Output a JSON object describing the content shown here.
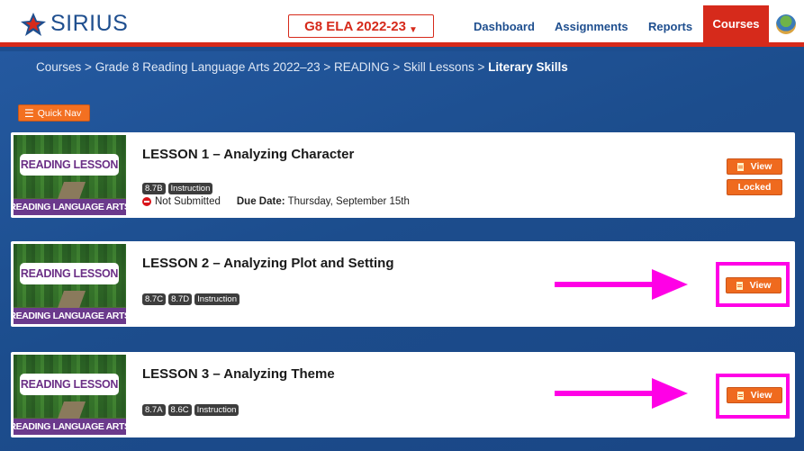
{
  "brand": {
    "name": "SIRIUS"
  },
  "course_selector": {
    "value": "G8 ELA 2022-23"
  },
  "nav": {
    "dashboard": "Dashboard",
    "assignments": "Assignments",
    "reports": "Reports",
    "courses": "Courses"
  },
  "breadcrumb": {
    "items": [
      "Courses",
      "Grade 8 Reading Language Arts 2022–23",
      "READING",
      "Skill Lessons"
    ],
    "separator": ">",
    "current": "Literary Skills"
  },
  "quick_nav": {
    "label": "Quick Nav"
  },
  "thumbnail": {
    "top_label": "READING LESSON",
    "bottom_label": "READING LANGUAGE ARTS"
  },
  "lessons": [
    {
      "title": "LESSON 1 – Analyzing Character",
      "tags": [
        "8.7B",
        "Instruction"
      ],
      "status": "Not Submitted",
      "due_label": "Due Date:",
      "due_value": "Thursday, September 15th",
      "view_label": "View",
      "locked_label": "Locked"
    },
    {
      "title": "LESSON 2 – Analyzing Plot and Setting",
      "tags": [
        "8.7C",
        "8.7D",
        "Instruction"
      ],
      "view_label": "View"
    },
    {
      "title": "LESSON 3 – Analyzing Theme",
      "tags": [
        "8.7A",
        "8.6C",
        "Instruction"
      ],
      "view_label": "View"
    }
  ],
  "colors": {
    "brand_blue": "#1f4f8f",
    "accent_red": "#d62a1b",
    "button_orange": "#ef6a1e",
    "annotation_magenta": "#ff00e6",
    "thumb_purple": "#6b3a8c"
  }
}
